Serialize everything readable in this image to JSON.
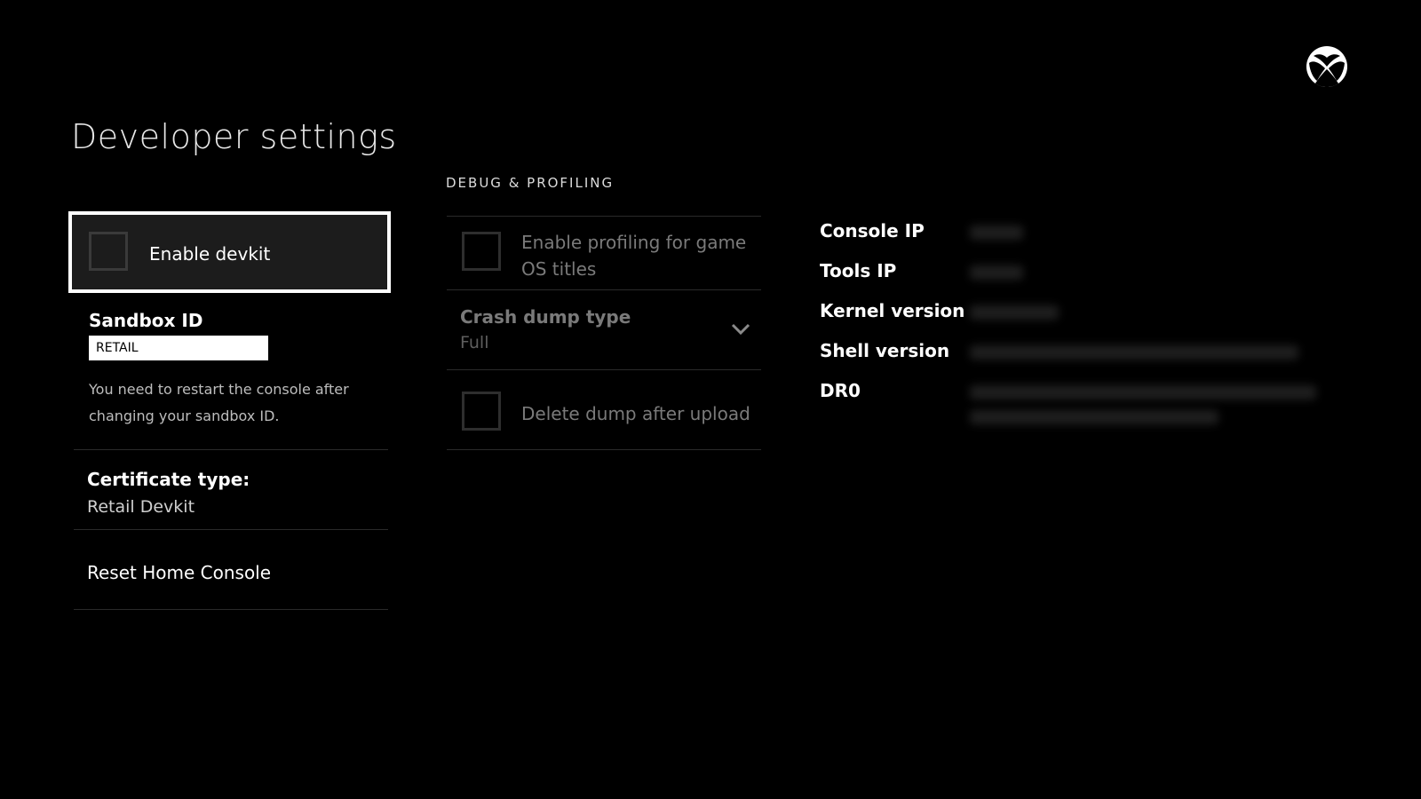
{
  "page": {
    "title": "Developer settings"
  },
  "left": {
    "enable_devkit": {
      "label": "Enable devkit",
      "checked": false
    },
    "sandbox": {
      "label": "Sandbox ID",
      "value": "RETAIL",
      "note": "You need to restart the console after changing your sandbox ID."
    },
    "certificate": {
      "label": "Certificate type:",
      "value": "Retail Devkit"
    },
    "reset": {
      "label": "Reset Home Console"
    }
  },
  "debug": {
    "heading": "DEBUG & PROFILING",
    "profiling": {
      "label": "Enable profiling for game OS titles",
      "checked": false
    },
    "crash_dump": {
      "label": "Crash dump type",
      "value": "Full"
    },
    "delete_dump": {
      "label": "Delete dump after upload",
      "checked": false
    }
  },
  "info": {
    "console_ip": "Console IP",
    "tools_ip": "Tools IP",
    "kernel_version": "Kernel version",
    "shell_version": "Shell version",
    "dr0": "DR0"
  },
  "icons": {
    "logo": "xbox-logo-icon",
    "dropdown": "chevron-down-icon"
  },
  "colors": {
    "background": "#000000",
    "focus_border": "#ffffff",
    "disabled_text": "#7a7a7a"
  }
}
